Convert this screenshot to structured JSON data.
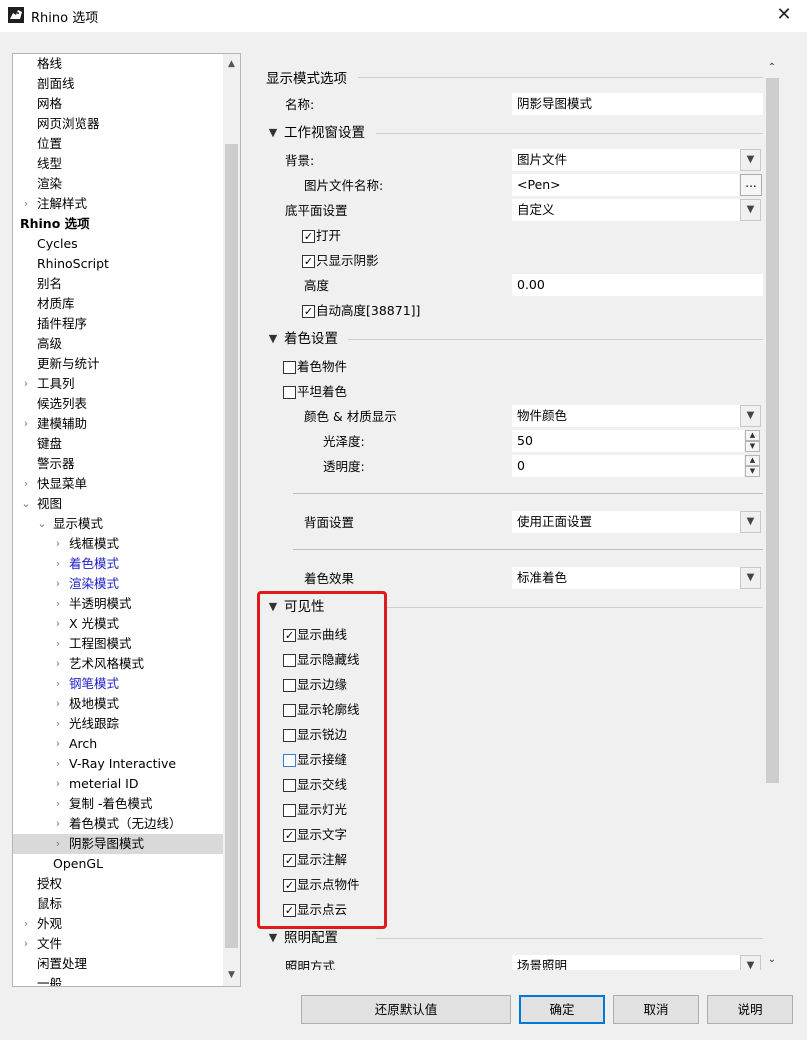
{
  "window": {
    "title": "Rhino 选项",
    "close_glyph": "✕"
  },
  "tree": {
    "items": [
      {
        "label": "格线",
        "indent": 0,
        "chev": ""
      },
      {
        "label": "剖面线",
        "indent": 0,
        "chev": ""
      },
      {
        "label": "网格",
        "indent": 0,
        "chev": ""
      },
      {
        "label": "网页浏览器",
        "indent": 0,
        "chev": ""
      },
      {
        "label": "位置",
        "indent": 0,
        "chev": ""
      },
      {
        "label": "线型",
        "indent": 0,
        "chev": ""
      },
      {
        "label": "渲染",
        "indent": 0,
        "chev": ""
      },
      {
        "label": "注解样式",
        "indent": 0,
        "chev": ">"
      },
      {
        "label": "Rhino 选项",
        "indent": -1,
        "chev": "",
        "bold": true
      },
      {
        "label": "Cycles",
        "indent": 0,
        "chev": ""
      },
      {
        "label": "RhinoScript",
        "indent": 0,
        "chev": ""
      },
      {
        "label": "别名",
        "indent": 0,
        "chev": ""
      },
      {
        "label": "材质库",
        "indent": 0,
        "chev": ""
      },
      {
        "label": "插件程序",
        "indent": 0,
        "chev": ""
      },
      {
        "label": "高级",
        "indent": 0,
        "chev": ""
      },
      {
        "label": "更新与统计",
        "indent": 0,
        "chev": ""
      },
      {
        "label": "工具列",
        "indent": 0,
        "chev": ">"
      },
      {
        "label": "候选列表",
        "indent": 0,
        "chev": ""
      },
      {
        "label": "建模辅助",
        "indent": 0,
        "chev": ">"
      },
      {
        "label": "键盘",
        "indent": 0,
        "chev": ""
      },
      {
        "label": "警示器",
        "indent": 0,
        "chev": ""
      },
      {
        "label": "快显菜单",
        "indent": 0,
        "chev": ">"
      },
      {
        "label": "视图",
        "indent": 0,
        "chev": "v"
      },
      {
        "label": "显示模式",
        "indent": 1,
        "chev": "v"
      },
      {
        "label": "线框模式",
        "indent": 2,
        "chev": ">"
      },
      {
        "label": "着色模式",
        "indent": 2,
        "chev": ">",
        "link": true
      },
      {
        "label": "渲染模式",
        "indent": 2,
        "chev": ">",
        "link": true
      },
      {
        "label": "半透明模式",
        "indent": 2,
        "chev": ">"
      },
      {
        "label": "X 光模式",
        "indent": 2,
        "chev": ">"
      },
      {
        "label": "工程图模式",
        "indent": 2,
        "chev": ">"
      },
      {
        "label": "艺术风格模式",
        "indent": 2,
        "chev": ">"
      },
      {
        "label": "钢笔模式",
        "indent": 2,
        "chev": ">",
        "link": true
      },
      {
        "label": "极地模式",
        "indent": 2,
        "chev": ">"
      },
      {
        "label": "光线跟踪",
        "indent": 2,
        "chev": ">"
      },
      {
        "label": "Arch",
        "indent": 2,
        "chev": ">"
      },
      {
        "label": "V-Ray Interactive",
        "indent": 2,
        "chev": ">"
      },
      {
        "label": "meterial ID",
        "indent": 2,
        "chev": ">"
      },
      {
        "label": "复制 -着色模式",
        "indent": 2,
        "chev": ">"
      },
      {
        "label": "着色模式（无边线）",
        "indent": 2,
        "chev": ">"
      },
      {
        "label": "阴影导图模式",
        "indent": 2,
        "chev": ">",
        "selected": true
      },
      {
        "label": "OpenGL",
        "indent": 1,
        "chev": ""
      },
      {
        "label": "授权",
        "indent": 0,
        "chev": ""
      },
      {
        "label": "鼠标",
        "indent": 0,
        "chev": ""
      },
      {
        "label": "外观",
        "indent": 0,
        "chev": ">"
      },
      {
        "label": "文件",
        "indent": 0,
        "chev": ">"
      },
      {
        "label": "闲置处理",
        "indent": 0,
        "chev": ""
      },
      {
        "label": "一般",
        "indent": 0,
        "chev": ""
      }
    ]
  },
  "panel": {
    "display_mode_options": "显示模式选项",
    "name_label": "名称:",
    "name_value": "阴影导图模式",
    "viewport_section": "工作视窗设置",
    "background_label": "背景:",
    "background_value": "图片文件",
    "image_file_label": "图片文件名称:",
    "image_file_value": "<Pen>",
    "image_file_button": "...",
    "ground_plane_label": "底平面设置",
    "ground_plane_value": "自定义",
    "cb_on": "打开",
    "cb_shadow_only": "只显示阴影",
    "height_label": "高度",
    "height_value": "0.00",
    "cb_auto_height": "自动高度[38871]]",
    "shading_section": "着色设置",
    "cb_shade_objects": "着色物件",
    "cb_flat_shading": "平坦着色",
    "color_material_label": "颜色 & 材质显示",
    "color_material_value": "物件颜色",
    "gloss_label": "光泽度:",
    "gloss_value": "50",
    "transparency_label": "透明度:",
    "transparency_value": "0",
    "backface_label": "背面设置",
    "backface_value": "使用正面设置",
    "shading_effect_label": "着色效果",
    "shading_effect_value": "标准着色",
    "visibility_section": "可见性",
    "visibility_items": [
      {
        "label": "显示曲线",
        "checked": true
      },
      {
        "label": "显示隐藏线",
        "checked": false
      },
      {
        "label": "显示边缘",
        "checked": false
      },
      {
        "label": "显示轮廓线",
        "checked": false
      },
      {
        "label": "显示锐边",
        "checked": false
      },
      {
        "label": "显示接缝",
        "checked": false,
        "focus": true
      },
      {
        "label": "显示交线",
        "checked": false
      },
      {
        "label": "显示灯光",
        "checked": false
      },
      {
        "label": "显示文字",
        "checked": true
      },
      {
        "label": "显示注解",
        "checked": true
      },
      {
        "label": "显示点物件",
        "checked": true
      },
      {
        "label": "显示点云",
        "checked": true
      }
    ],
    "lighting_section": "照明配置",
    "lighting_method_label": "照明方式",
    "lighting_method_value": "场景照明"
  },
  "buttons": {
    "restore": "还原默认值",
    "ok": "确定",
    "cancel": "取消",
    "help": "说明"
  },
  "colors": {
    "highlight": "#e0191c",
    "link": "#2020c8",
    "default_button": "#0078d7"
  }
}
